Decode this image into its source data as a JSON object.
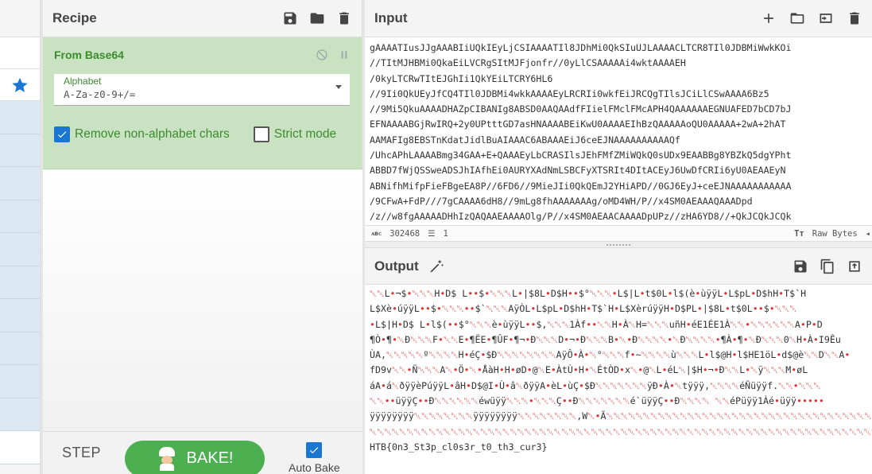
{
  "recipe": {
    "title": "Recipe",
    "operation": {
      "name": "From Base64",
      "alphabet_label": "Alphabet",
      "alphabet_value": "A-Za-z0-9+/=",
      "remove_non_alpha_label": "Remove non-alphabet chars",
      "remove_non_alpha_checked": true,
      "strict_mode_label": "Strict mode",
      "strict_mode_checked": false
    },
    "step_label": "STEP",
    "bake_label": "BAKE!",
    "auto_bake_label": "Auto Bake",
    "auto_bake_checked": true
  },
  "input": {
    "title": "Input",
    "lines": [
      "gAAAATIusJJgAAABIiUQkIEyLjCSIAAAATIl8JDhMi0QkSIuUJLAAAACLTCR8TIl0JDBMiWwkKOi",
      "//TItMJHBMi0QkaEiLVCRgSItMJFjonfr//0yLlCSAAAAAi4wktAAAAEH",
      "/0kyLTCRwTItEJGhIi1QkYEiLTCRY6HL6",
      "//9Ii0QkUEyJfCQ4TIl0JDBMi4wkkAAAAEyLRCRIi0wkfEiJRCQgTIlsJCiLlCSwAAAA6Bz5",
      "//9Mi5QkuAAAADHAZpCIBANIg8ABSD0AAQAAdfFIielFMclFMcAPH4QAAAAAAEGNUAFED7bCD7bJ",
      "EFNAAAABGjRwIRQ+2y0UPtttGD7asHNAAAABEiKwU0AAAAEIhBzQAAAAAoQU0AAAAA+2wA+2hAT",
      "AAMAFIg8EBSTnKdatJidlBuAIAAAC6ABAAAEiJ6ceEJNAAAAAAAAAAQf",
      "/UhcAPhLAAAABmg34GAA+E+QAAAEyLbCRASIlsJEhFMfZMiWQkQ0sUDx9EAABBg8YBZkQ5dgYPht",
      "ABBD7fWjQSSweADSJhIAfhEi0AURYXAdNmLSBCFyXTSRIt4DItACEyJ6UwDfCRIi6yU0AEAAEyN",
      "ABNifhMifpFieFBgeEA8P//6FD6//9MieJIi0QkQEmJ2YHiAPD//0GJ6EyJ+ceEJNAAAAAAAAAAA",
      "/9CFwA+FdP///7gCAAAA6dH8//9mLg8fhAAAAAAAg/oMD4WH/P//x4SM0AEAAAQAAADpd",
      "/z//w8fgAAAAADHhIzQAQAAEAAAAOlg/P//x4SM0AEAACAAAADpUPz//zHA6YD8//+QkJCQkJCQk"
    ],
    "char_count": "302468",
    "line_count": "1",
    "raw_bytes_label": "Raw Bytes"
  },
  "output": {
    "title": "Output",
    "lines": [
      "␀␀L•¬$•␀␀␀H•D$ L••$•␀␀␀L•|$8L•D$H••$°␀␀␀•L$|L•t$0L•l$(è•ùÿÿL•L$pL•D$hH•T$`H",
      "L$Xè•úÿÿL••$•␀␀␀••$`␀␀␀AÿÒL•L$pL•D$hH•T$`H•L$XèrúÿÿH•D$PL•|$8L•t$0L••$•␀␀␀",
      "•L$|H•D$ L•l$(••$°␀␀␀è•ùÿÿL••$,␀␀␀1Àf••␀␀H•À␀H=␀␀␀uñH•éE1ÉE1À␀␀•␀␀␀␀␀␀A•P•D",
      "¶Ò•¶•␀Ð␀␀␀F•␀␀E•¶ËE•¶ÛF•¶¬•Ð␀␀␀D•¬•Ð␀␀␀B•␀•Ð␀␀␀␀•␀Ð␀␀␀␀•¶À•¶•␀Ð␀␀␀0␀H•À•I9Êu",
      "ÙA,␀␀␀␀␀º␀␀␀␀H•éÇ•$Ð␀␀␀␀␀␀␀␀AÿÔ•À•␀°␀␀␀f•~␀␀␀␀ù␀␀␀L•l$@H•l$HE1öL•d$@è␀␀D␀␀A•",
      "fD9v␀␀•Ñ␀␀␀A␀•Ö•␀•ÅàH•H•øD•@␀E•ÀtÙ•H•␀ÉtÒD•x␀•@␀L•éL␀|$H•¬•Ð␀␀L•␀ÿ␀␀␀M•øL",
      "áA•á␀ðÿÿèPúÿÿL•âH•D$@I•Ù•â␀ðÿÿA•èL•ùÇ•$Ð␀␀␀␀␀␀␀ÿÐ•À•␀tÿÿÿ,␀␀␀␀éÑüÿÿf.␀␀•␀␀␀",
      "␀␀••üÿÿÇ••Ð␀␀␀␀␀␀éwüÿÿ␀␀␀•␀␀␀Ç••Ð␀␀␀␀␀␀␀é`üÿÿÇ••Ð␀␀␀␀ ␀␀éPüÿÿ1Àé•üÿÿ•••••",
      "ÿÿÿÿÿÿÿÿ␀␀␀␀␀␀␀␀ÿÿÿÿÿÿÿÿ␀␀␀␀␀␀␀␀,W␀•Ã␀␀␀␀␀␀␀␀␀␀␀␀␀␀␀␀␀␀␀␀␀␀␀␀␀␀␀␀␀␀␀␀␀␀␀␀␀␀",
      "␀␀␀␀␀␀␀␀␀␀␀␀␀␀␀␀␀␀␀␀␀␀␀␀␀␀␀␀␀␀␀␀␀␀␀␀␀␀␀␀␀␀␀␀␀␀␀␀␀␀␀␀␀␀␀␀␀␀␀␀␀␀␀␀␀␀␀␀␀",
      "HTB{0n3_St3p_cl0s3r_t0_th3_cur3}"
    ]
  },
  "colors": {
    "accent_green": "#3c8b2f",
    "op_bg": "#c9e3c2",
    "bake_green": "#4caf50",
    "checkbox_blue": "#1976d2",
    "fav_star": "#1976d2"
  }
}
